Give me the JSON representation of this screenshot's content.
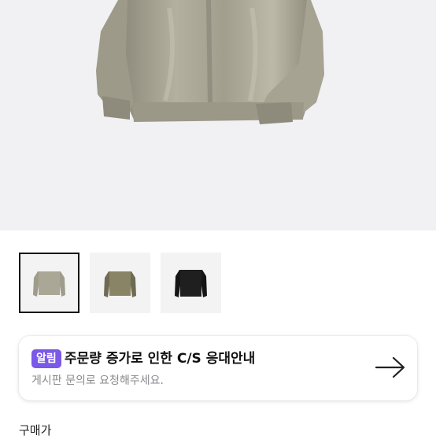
{
  "gallery": {
    "thumbnails": [
      {
        "color": "sand-gray",
        "selected": true
      },
      {
        "color": "olive-khaki",
        "selected": false
      },
      {
        "color": "black",
        "selected": false
      }
    ]
  },
  "notice": {
    "badge": "알림",
    "title": "주문량 증가로 인한 C/S 응대안내",
    "subtitle": "게시판 문의로 요청해주세요.",
    "icon": "arrow-right-icon",
    "badge_color": "#7a58e8"
  },
  "price_section": {
    "label": "구매가"
  }
}
